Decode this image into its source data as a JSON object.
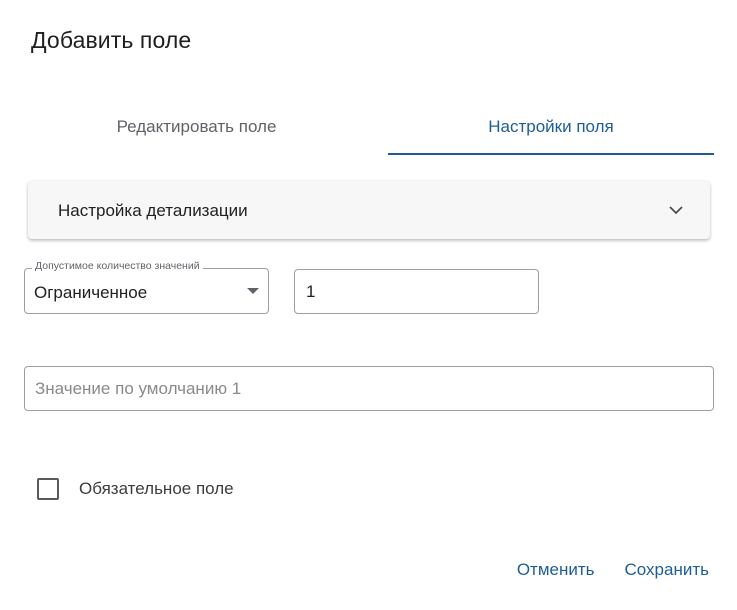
{
  "dialog": {
    "title": "Добавить поле"
  },
  "tabs": [
    {
      "label": "Редактировать поле",
      "active": false
    },
    {
      "label": "Настройки поля",
      "active": true
    }
  ],
  "accordion": {
    "label": "Настройка детализации",
    "icon": "chevron-down-icon"
  },
  "values_count": {
    "legend": "Допустимое количество значений",
    "selected": "Ограниченное",
    "count_value": "1"
  },
  "default_value": {
    "placeholder": "Значение по умолчанию 1",
    "value": ""
  },
  "required_checkbox": {
    "label": "Обязательное поле",
    "checked": false
  },
  "actions": {
    "cancel_label": "Отменить",
    "save_label": "Сохранить"
  },
  "colors": {
    "accent": "#1d5e96",
    "text": "#212121",
    "border": "#9e9e9e",
    "accordion_bg": "#f7f7f7"
  }
}
